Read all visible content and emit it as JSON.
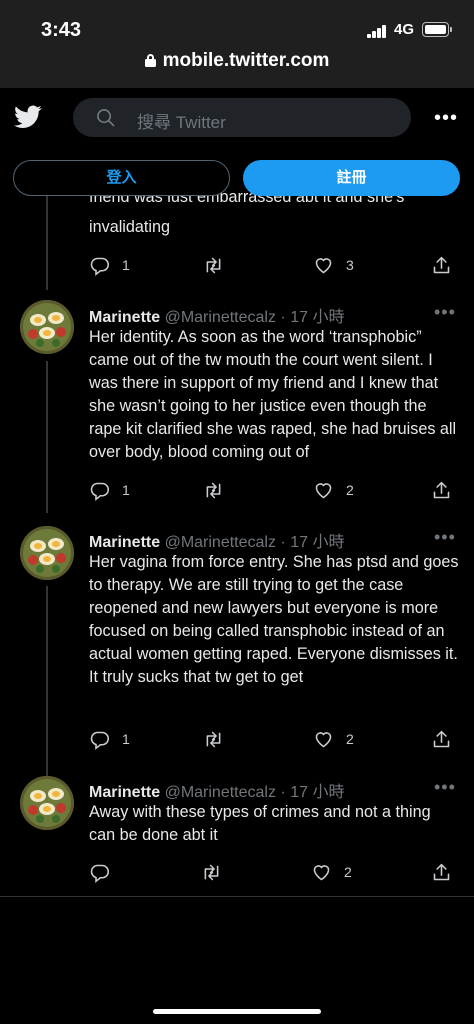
{
  "status": {
    "time": "3:43",
    "network": "4G",
    "url": "mobile.twitter.com"
  },
  "header": {
    "search_placeholder": "搜尋 Twitter"
  },
  "buttons": {
    "login": "登入",
    "signup": "註冊"
  },
  "partial_tweet": {
    "text_cut": "friend was just embarrassed abt it and she's",
    "text": "invalidating",
    "replies": "1",
    "retweets": "",
    "likes": "3"
  },
  "tweets": [
    {
      "name": "Marinette",
      "handle": "@Marinettecalz",
      "time": "· 17 小時",
      "text": "Her identity. As soon as the word ‘transphobic” came out of the tw mouth the court went silent. I was there in support of my friend and I knew that she wasn’t going to her justice even though the rape kit clarified she was raped, she had bruises all over body, blood coming out of",
      "replies": "1",
      "likes": "2"
    },
    {
      "name": "Marinette",
      "handle": "@Marinettecalz",
      "time": "· 17 小時",
      "text": "Her vagina from force entry. She has ptsd and goes to therapy. We are still trying to get the case reopened and new lawyers but everyone is more focused on being called transphobic instead of an actual women getting raped. Everyone dismisses it. It truly sucks that tw get to get",
      "replies": "1",
      "likes": "2"
    },
    {
      "name": "Marinette",
      "handle": "@Marinettecalz",
      "time": "· 17 小時",
      "text": "Away with these types of crimes and not a thing can be done abt it",
      "replies": "",
      "likes": "2"
    }
  ],
  "icons": {
    "reply": "reply-icon",
    "retweet": "retweet-icon",
    "like": "heart-icon",
    "share": "share-icon",
    "accent": "#1d9bf0"
  }
}
